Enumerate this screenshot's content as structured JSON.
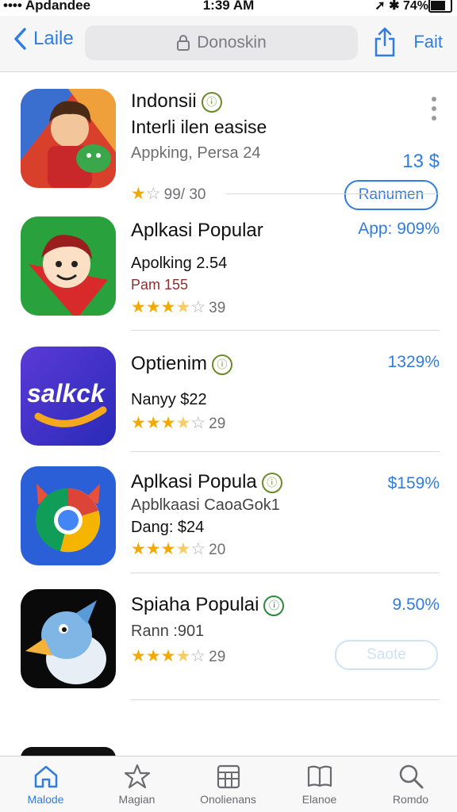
{
  "status_bar": {
    "carrier": "•••• Apdandee",
    "time": "1:39 AM",
    "battery": "74%"
  },
  "nav": {
    "back_label": "Laile",
    "search_text": "Donoskin",
    "action_label": "Fait"
  },
  "apps": [
    {
      "title": "Indonsii",
      "subtitle": "Interli ilen easise",
      "meta": "Appking, Persa 24",
      "rating_text": "99/ 30",
      "stars": 1,
      "price": "13 $",
      "button": "Ranumen"
    },
    {
      "title": "Aplkasi Popular",
      "subtitle": "Apolking 2.54",
      "meta": "Pam 155",
      "rating_text": "39",
      "stars": 3.5,
      "price": "App: 909%"
    },
    {
      "title": "Optienim",
      "subtitle": "Nanyy $22",
      "rating_text": "29",
      "stars": 3.5,
      "price": "1329%",
      "icon_text": "salkck"
    },
    {
      "title": "Aplkasi Popula",
      "subtitle": "Apblkaasi CaoaGok1",
      "meta": "Dang: $24",
      "rating_text": "20",
      "stars": 3.5,
      "price": "$159%"
    },
    {
      "title": "Spiaha Populai",
      "subtitle": "Rann :901",
      "rating_text": "29",
      "stars": 3.5,
      "price": "9.50%",
      "button": "Saote"
    }
  ],
  "tabs": [
    {
      "label": "Malode"
    },
    {
      "label": "Magian"
    },
    {
      "label": "Onolienans"
    },
    {
      "label": "Elanoe"
    },
    {
      "label": "Romdo"
    }
  ],
  "colors": {
    "accent": "#2f7de1",
    "star": "#f2a900"
  }
}
